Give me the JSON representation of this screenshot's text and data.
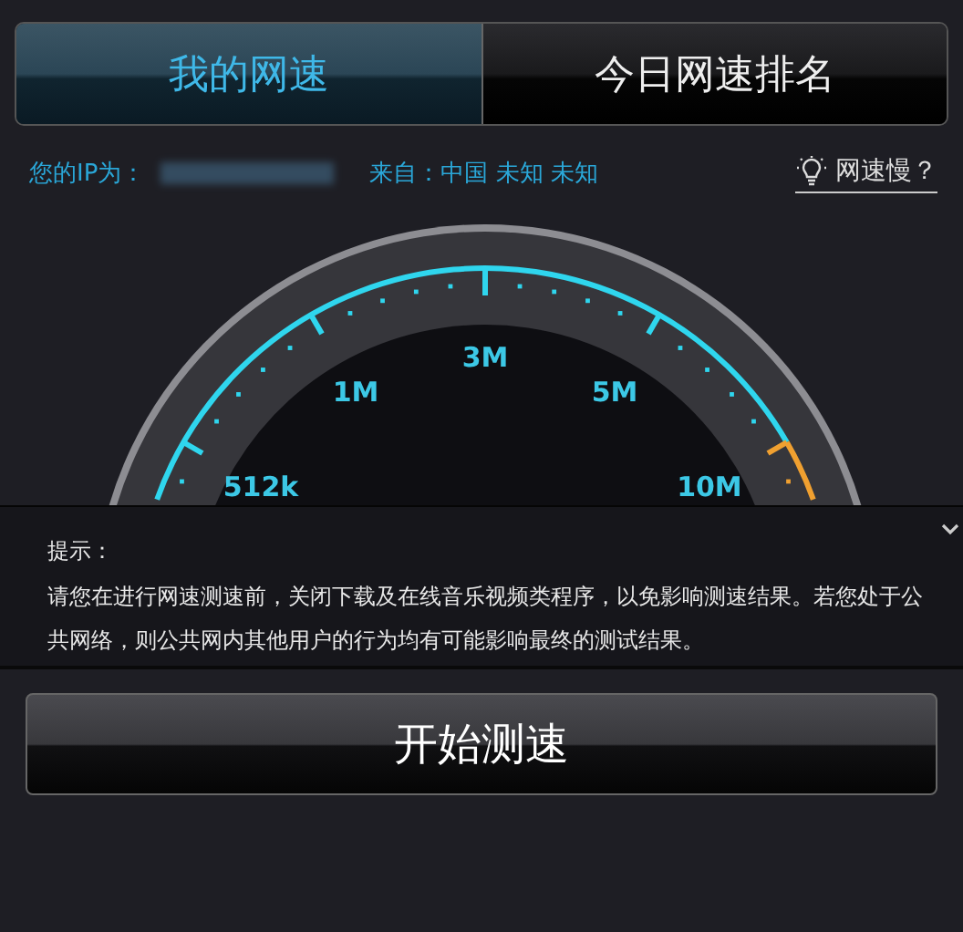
{
  "tabs": [
    {
      "label": "我的网速",
      "selected": true
    },
    {
      "label": "今日网速排名",
      "selected": false
    }
  ],
  "info": {
    "ip_label": "您的IP为：",
    "ip_hidden": true,
    "origin": "来自：中国 未知 未知",
    "help_link": "网速慢？"
  },
  "gauge": {
    "labels": [
      "512k",
      "1M",
      "3M",
      "5M",
      "10M"
    ]
  },
  "tip": {
    "title": "提示：",
    "body": "请您在进行网速测速前，关闭下载及在线音乐视频类程序，以免影响测速结果。若您处于公共网络，则公共网内其他用户的行为均有可能影响最终的测试结果。"
  },
  "start_button": "开始测速"
}
